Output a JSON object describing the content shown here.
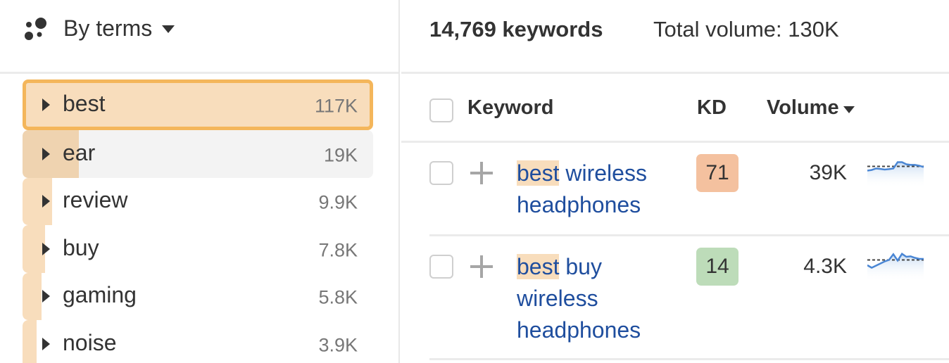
{
  "left_panel": {
    "group_by": {
      "icon": "clusters-icon",
      "label": "By terms"
    },
    "terms": [
      {
        "label": "best",
        "count": "117K",
        "share": 1.0,
        "state": "selected"
      },
      {
        "label": "ear",
        "count": "19K",
        "share": 0.162,
        "state": "hover"
      },
      {
        "label": "review",
        "count": "9.9K",
        "share": 0.085,
        "state": ""
      },
      {
        "label": "buy",
        "count": "7.8K",
        "share": 0.067,
        "state": ""
      },
      {
        "label": "gaming",
        "count": "5.8K",
        "share": 0.05,
        "state": ""
      },
      {
        "label": "noise",
        "count": "3.9K",
        "share": 0.033,
        "state": ""
      }
    ]
  },
  "summary": {
    "keywords": "14,769 keywords",
    "total_volume": "Total volume: 130K"
  },
  "table": {
    "headers": {
      "keyword": "Keyword",
      "kd": "KD",
      "volume": "Volume"
    },
    "rows": [
      {
        "highlight": "best",
        "rest": " wireless headphones",
        "kd": "71",
        "kd_color": "#f4c19f",
        "volume": "39K",
        "trend": [
          0.35,
          0.38,
          0.45,
          0.43,
          0.4,
          0.42,
          0.45,
          0.75,
          0.75,
          0.65,
          0.62,
          0.62,
          0.58,
          0.52
        ],
        "trend_avg": 0.55
      },
      {
        "highlight": "best",
        "rest": " buy wireless headphones",
        "kd": "14",
        "kd_color": "#bddcb9",
        "volume": "4.3K",
        "trend": [
          0.3,
          0.18,
          0.28,
          0.38,
          0.48,
          0.55,
          0.82,
          0.52,
          0.84,
          0.7,
          0.72,
          0.65,
          0.6,
          0.6
        ],
        "trend_avg": 0.55
      }
    ]
  },
  "colors": {
    "accent_bar": "#f8ddbc",
    "selected_border": "#f4b65b",
    "link": "#1f4e9e",
    "trend_line": "#4a86d4"
  }
}
